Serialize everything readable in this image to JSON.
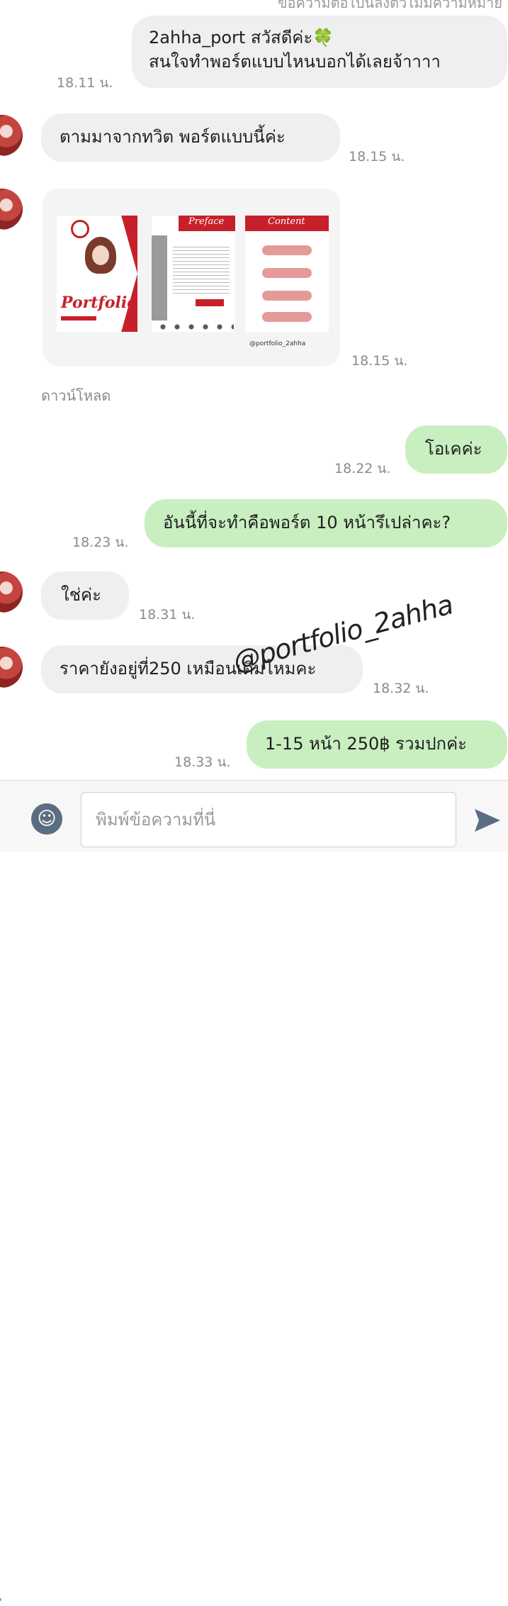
{
  "notice": {
    "text": "ข้อความต่อไปนี้ลงตัวไม่มีความหมาย"
  },
  "messages": [
    {
      "side": "out",
      "text_lines": [
        "2ahha_port สวัสดีค่ะ🍀",
        "สนใจทำพอร์ตแบบไหนบอกได้เลยจ้าาาา"
      ],
      "time": "18.11 น."
    },
    {
      "side": "in",
      "text": "ตามมาจากทวิต พอร์ตแบบนี้ค่ะ",
      "time": "18.15 น."
    },
    {
      "side": "in",
      "type": "image",
      "time": "18.15 น.",
      "download": "ดาวน์โหลด",
      "preview": {
        "cover_title": "Portfolio",
        "preface_title": "Preface",
        "content_title": "Content",
        "tag": "@portfolio_2ahha"
      }
    },
    {
      "side": "out",
      "text": "โอเคค่ะ",
      "time": "18.22 น."
    },
    {
      "side": "out",
      "text": "อันนี้ที่จะทำคือพอร์ต 10 หน้ารึเปล่าคะ?",
      "time": "18.23 น."
    },
    {
      "side": "in",
      "text": "ใช่ค่ะ",
      "time": "18.31 น."
    },
    {
      "side": "in",
      "text": "ราคายังอยู่ที่250 เหมือนเดิมไหมคะ",
      "time": "18.32 น."
    },
    {
      "side": "out",
      "text": "1-15 หน้า 250฿ รวมปกค่ะ",
      "time": "18.33 น."
    }
  ],
  "watermark": "@portfolio_2ahha",
  "composer": {
    "placeholder": "พิมพ์ข้อความที่นี่",
    "emoji_icon": "smile-icon",
    "send_icon": "send-icon"
  },
  "colors": {
    "incoming_bubble": "#efeff1",
    "outgoing_bubble": "#c9efc0",
    "accent_red": "#c8202a"
  }
}
